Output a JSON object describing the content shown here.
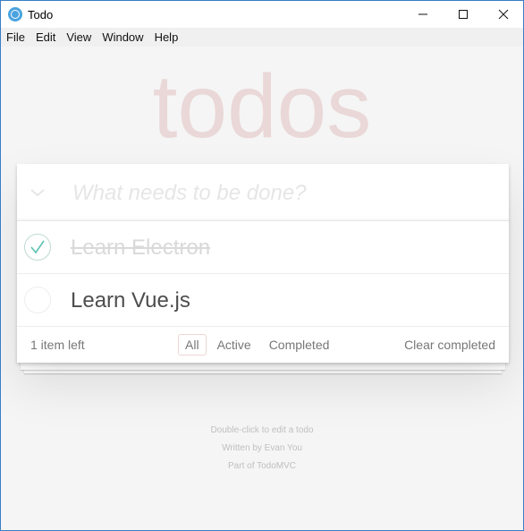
{
  "window": {
    "title": "Todo"
  },
  "menu": [
    "File",
    "Edit",
    "View",
    "Window",
    "Help"
  ],
  "app": {
    "heading": "todos",
    "new_todo_placeholder": "What needs to be done?",
    "todos": [
      {
        "title": "Learn Electron",
        "completed": true
      },
      {
        "title": "Learn Vue.js",
        "completed": false
      }
    ],
    "footer": {
      "count": "1 item left",
      "filters": [
        "All",
        "Active",
        "Completed"
      ],
      "selected_filter": "All",
      "clear": "Clear completed"
    }
  },
  "info": [
    "Double-click to edit a todo",
    "Written by Evan You",
    "Part of TodoMVC"
  ],
  "colors": {
    "heading": "#af2f2f",
    "check": "#5dc2af",
    "window_border": "#3a7fc4"
  }
}
